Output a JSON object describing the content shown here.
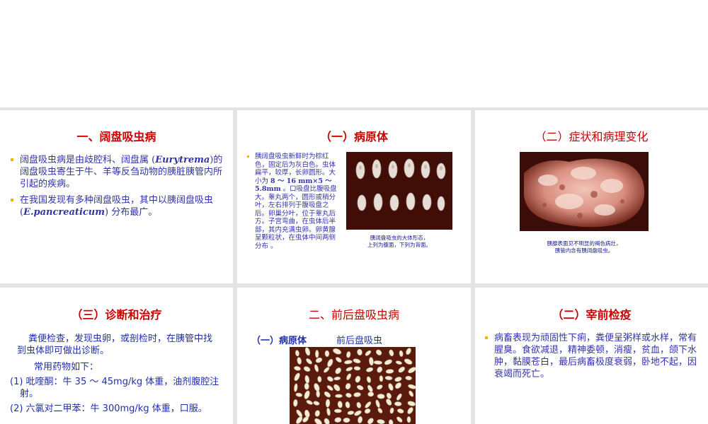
{
  "s1": {
    "title": "一、阔盘吸虫病",
    "b1_pre": "阔盘吸虫病是由歧腔科、阔盘属 (",
    "b1_genus": "Eurytrema",
    "b1_post": ")的阔盘吸虫寄生于牛、羊等反刍动物的胰脏胰管内所引起的疾病。",
    "b2_pre": "在我国发现有多种阔盘吸虫，其中以胰阔盘吸虫 (",
    "b2_species": "E.pancreaticum",
    "b2_post": ") 分布最广。"
  },
  "s2": {
    "title": "（一）病原体",
    "b_a": "胰阔盘吸虫新鲜时为棕红色，固定后为灰白色。虫体扁平，较厚，长卵圆形。大小为 ",
    "size_bold": "8 ～ 16 mm×5 ～ 5.8mm",
    "b_b": " 。口吸盘比腹吸盘大。睾丸两个，圆形或稍分叶，左右排列于腹吸盘之后。卵巢分叶，位于睾丸后方。子宫弯曲，在虫体后半部，其内充满虫卵。卵黄腺呈颗粒状，在虫体中间两侧分布 。",
    "caption_1": "胰阔盘吸虫的大体形态，",
    "caption_2": "上列为腹面，下列为背面。"
  },
  "s3": {
    "title": "（二）症状和病理变化",
    "caption_1": "胰腺表面见不明显的褐色病灶，",
    "caption_2": "胰管内含有胰阔盘吸虫。"
  },
  "s4": {
    "title": "（三）诊断和治疗",
    "p1": "粪便检查，发现虫卵，或剖检时，在胰管中找到虫体即可做出诊断。",
    "p2": "常用药物如下：",
    "p3": "(1) 吡喹酮：牛 35 ～ 45mg/kg 体重，油剂腹腔注射。",
    "p4": "(2) 六氯对二甲苯：牛 300mg/kg 体重，口服。"
  },
  "s5": {
    "title": "二、前后盘吸虫病",
    "sub_label": "（一）病原体",
    "sub_name": "前后盘吸虫"
  },
  "s6": {
    "title": "（二）宰前检疫",
    "b1": "病畜表现为顽固性下痢，粪便呈粥样或水样，常有腥臭。食欲减退，精神委顿，消瘦，贫血，颌下水肿，黏膜苍白，最后病畜极度衰弱，卧地不起，因衰竭而死亡。"
  },
  "colors": {
    "title": "#cc0000",
    "text": "#3333aa",
    "bullet": "#e8b800",
    "photo_bg": "#4a1208"
  },
  "icons": {
    "bullet": "square-bullet-icon"
  }
}
